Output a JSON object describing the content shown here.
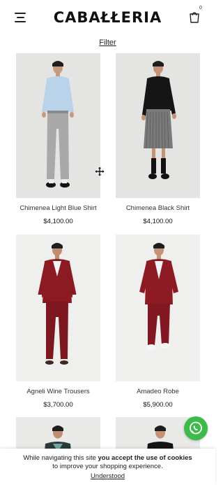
{
  "header": {
    "logo": "CABAŁŁERIA",
    "cart_count": "0"
  },
  "filter_label": "Filter",
  "products": [
    {
      "name": "Chimenea Light Blue Shirt",
      "price": "$4,100.00"
    },
    {
      "name": "Chimenea Black Shirt",
      "price": "$4,100.00"
    },
    {
      "name": "Agneli Wine Trousers",
      "price": "$3,700.00"
    },
    {
      "name": "Amadeo Robe",
      "price": "$5,900.00"
    },
    {
      "name": "",
      "price": ""
    },
    {
      "name": "",
      "price": ""
    }
  ],
  "cookie": {
    "text_before": "While navigating this site ",
    "text_bold": "you accept the use of cookies",
    "line2": "to improve your shopping experience.",
    "button": "Understood"
  },
  "colors": {
    "whatsapp": "#3dbb4a",
    "image_bg": "#e4e4e2",
    "wine": "#8b1a22"
  }
}
